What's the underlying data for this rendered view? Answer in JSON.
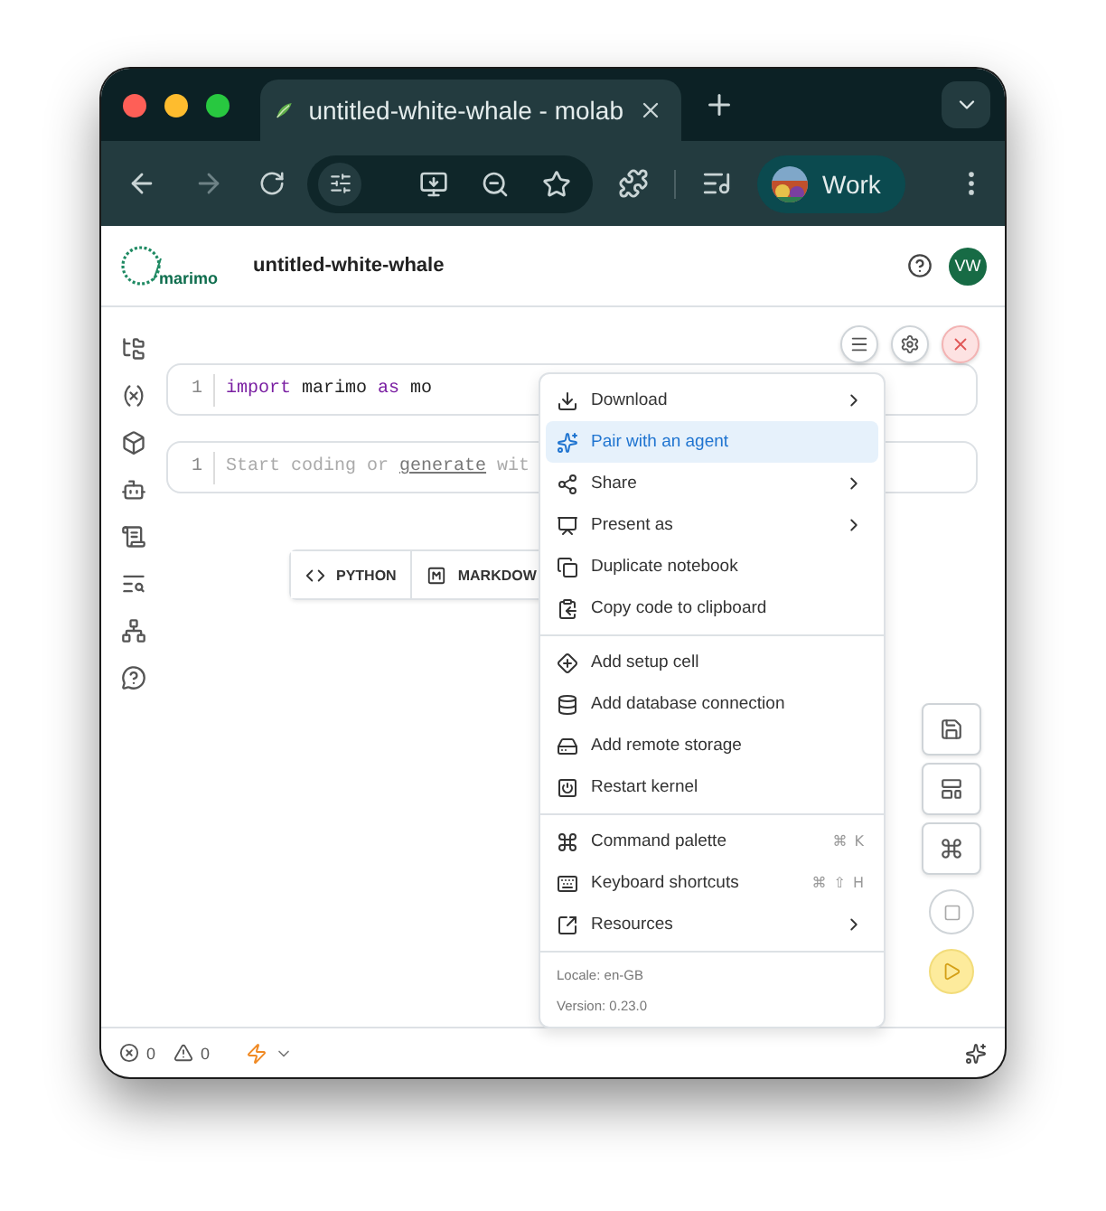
{
  "browser": {
    "tabs": [
      {
        "title": "untitled-white-whale - molab",
        "selected": true
      }
    ],
    "profile": "Work"
  },
  "app": {
    "logo": "marimo",
    "title": "untitled-white-whale",
    "avatar": "VW"
  },
  "cells": [
    {
      "kind": "code",
      "line_number": "1",
      "tokens": [
        {
          "text": "import",
          "keyword": true
        },
        {
          "text": " marimo ",
          "keyword": false
        },
        {
          "text": "as",
          "keyword": true
        },
        {
          "text": " mo",
          "keyword": false
        }
      ]
    },
    {
      "kind": "placeholder",
      "line_number": "1",
      "parts": [
        {
          "text": "Start coding or ",
          "link": false
        },
        {
          "text": "generate",
          "link": true
        },
        {
          "text": " wit",
          "link": false
        }
      ]
    }
  ],
  "add_cell": [
    "PYTHON",
    "MARKDOW"
  ],
  "menu": {
    "sections": [
      {
        "items": [
          {
            "label": "Download",
            "submenu": true,
            "selected": false
          },
          {
            "label": "Pair with an agent",
            "submenu": false,
            "selected": true
          },
          {
            "label": "Share",
            "submenu": true,
            "selected": false
          },
          {
            "label": "Present as",
            "submenu": true,
            "selected": false
          },
          {
            "label": "Duplicate notebook",
            "submenu": false,
            "selected": false
          },
          {
            "label": "Copy code to clipboard",
            "submenu": false,
            "selected": false
          }
        ]
      },
      {
        "items": [
          {
            "label": "Add setup cell",
            "submenu": false,
            "selected": false
          },
          {
            "label": "Add database connection",
            "submenu": false,
            "selected": false
          },
          {
            "label": "Add remote storage",
            "submenu": false,
            "selected": false
          },
          {
            "label": "Restart kernel",
            "submenu": false,
            "selected": false
          }
        ]
      },
      {
        "items": [
          {
            "label": "Command palette",
            "submenu": false,
            "selected": false,
            "shortcut": [
              "⌘",
              "K"
            ]
          },
          {
            "label": "Keyboard shortcuts",
            "submenu": false,
            "selected": false,
            "shortcut": [
              "⌘",
              "⇧",
              "H"
            ]
          },
          {
            "label": "Resources",
            "submenu": true,
            "selected": false
          }
        ]
      }
    ],
    "footer": [
      "Locale: en-GB",
      "Version: 0.23.0"
    ]
  },
  "status_bar": {
    "errors": "0",
    "warnings": "0"
  }
}
